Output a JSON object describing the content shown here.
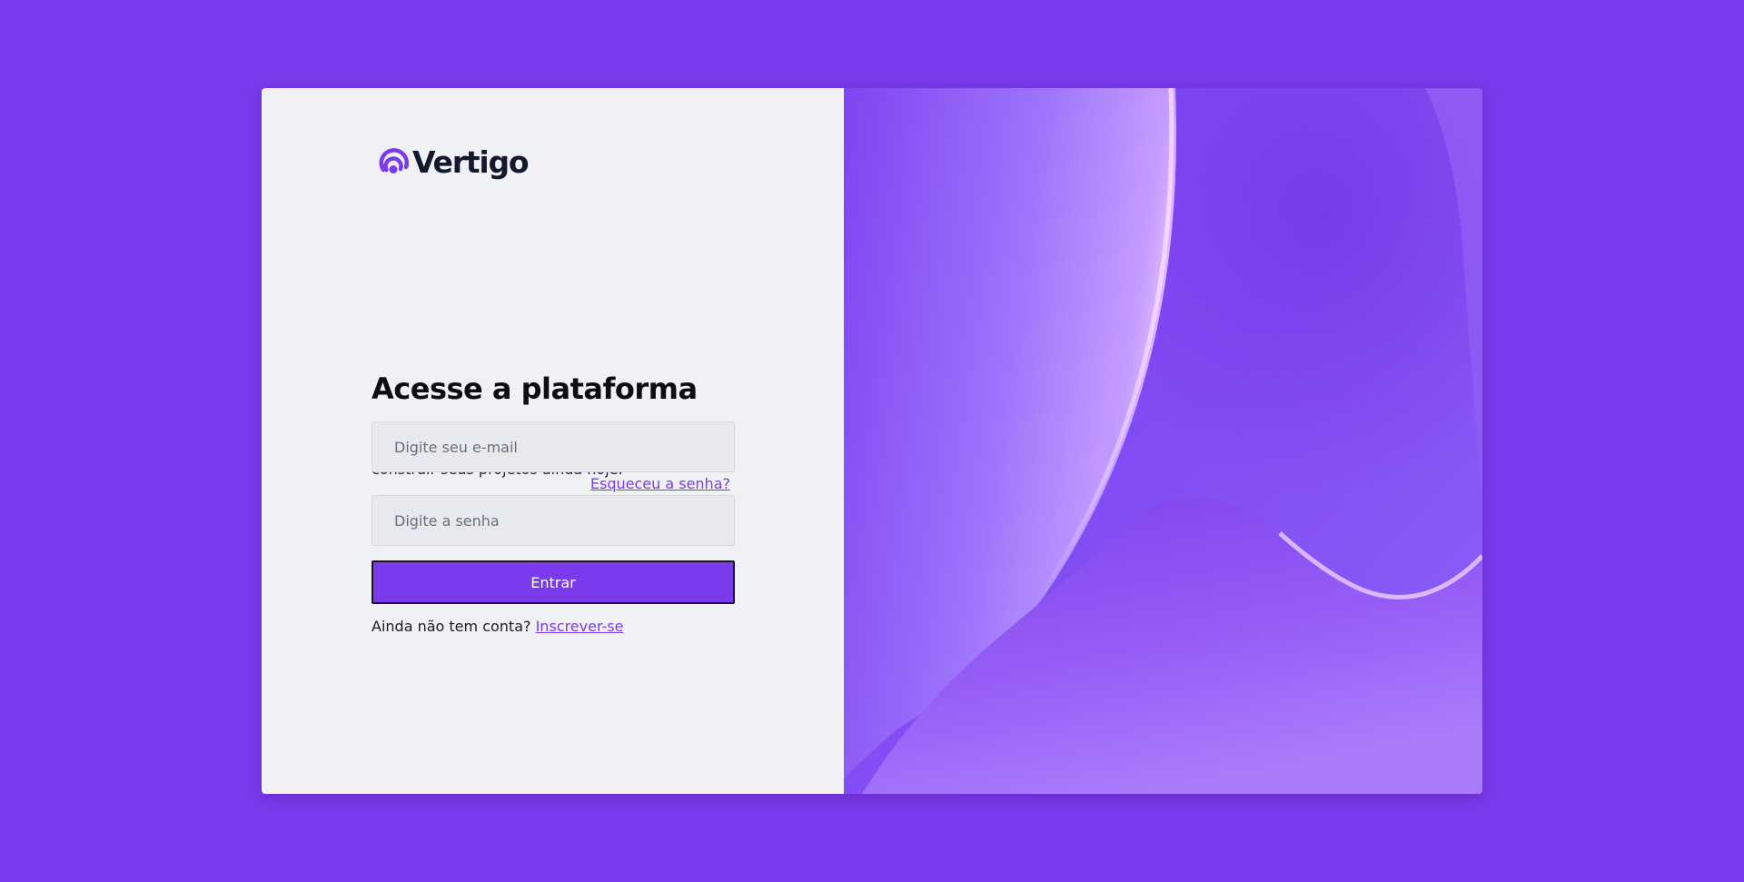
{
  "brand": {
    "name": "Vertigo",
    "logo_icon": "concentric-arcs-icon",
    "accent_color": "#7b3aec",
    "page_background": "#7b3aec"
  },
  "login": {
    "title": "Acesse a plataforma",
    "subtitle": "Faça login ou registre-se para começar a construir seus projetos ainda hoje.",
    "email_placeholder": "Digite seu e-mail",
    "email_value": "",
    "forgot_label": "Esqueceu a senha?",
    "password_placeholder": "Digite a senha",
    "password_value": "",
    "submit_label": "Entrar",
    "signup_prompt": "Ainda não tem conta?",
    "signup_link": "Inscrever-se"
  },
  "hero": {
    "image": "abstract-purple-waves-illustration"
  }
}
